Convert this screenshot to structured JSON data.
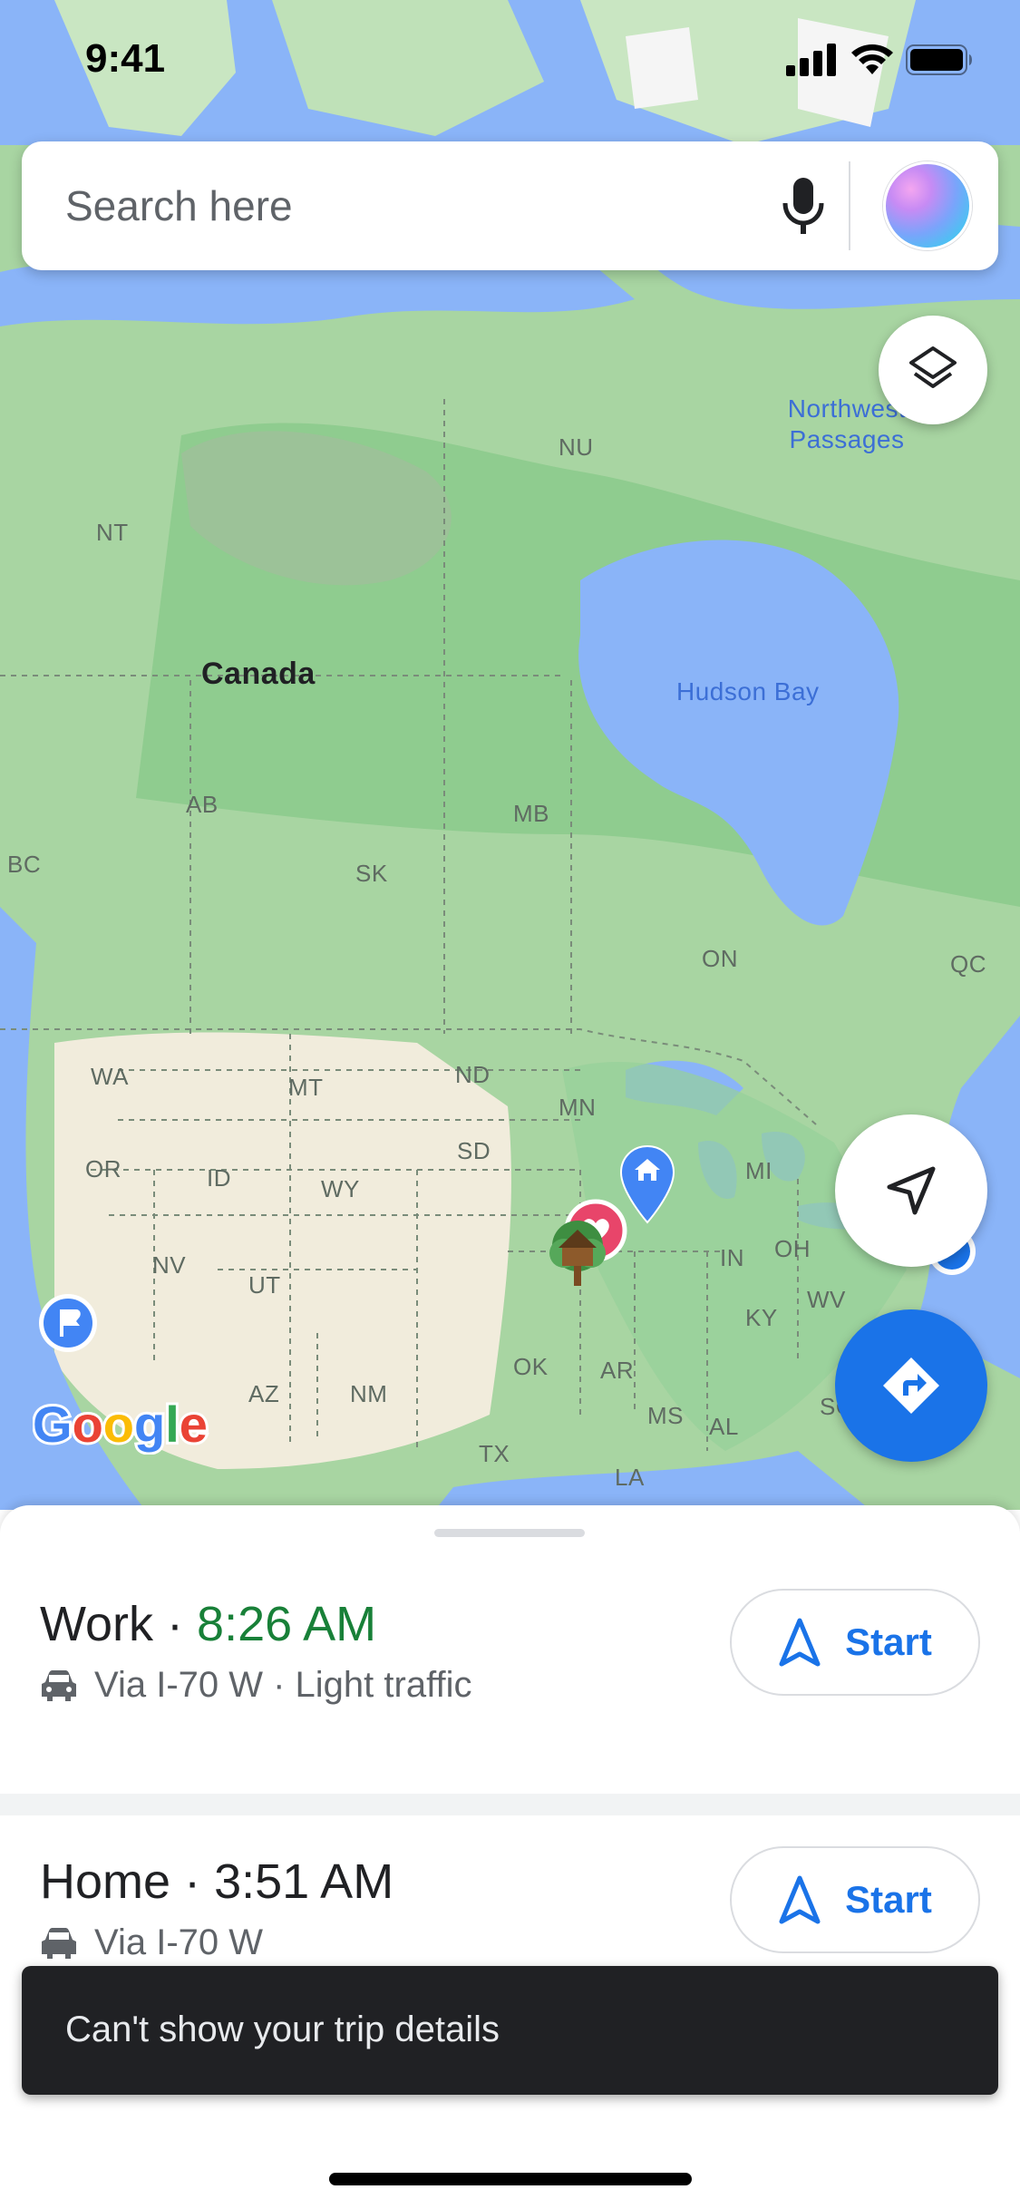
{
  "status_bar": {
    "time": "9:41"
  },
  "search": {
    "placeholder": "Search here"
  },
  "map": {
    "labels": {
      "nu": "NU",
      "nt": "NT",
      "canada": "Canada",
      "hudson_bay": "Hudson Bay",
      "northwest_passages": "Northwest\nPassages",
      "ab": "AB",
      "bc": "BC",
      "mb": "MB",
      "sk": "SK",
      "on": "ON",
      "qc": "QC",
      "wa": "WA",
      "mt": "MT",
      "nd": "ND",
      "mn": "MN",
      "or": "OR",
      "id": "ID",
      "wy": "WY",
      "sd": "SD",
      "mi": "MI",
      "nv": "NV",
      "ut": "UT",
      "in": "IN",
      "oh": "OH",
      "wv": "WV",
      "ky": "KY",
      "az": "AZ",
      "nm": "NM",
      "ok": "OK",
      "ar": "AR",
      "ms": "MS",
      "al": "AL",
      "sc": "SC",
      "tx": "TX",
      "la": "LA"
    },
    "logo": "Google",
    "markers": [
      "home-marker",
      "favorite-marker",
      "treehouse-marker",
      "parking-marker"
    ],
    "colors": {
      "water": "#8ab4f8",
      "land": "#a8d5a2",
      "forest": "#8fcc8f",
      "desert": "#f1ecdc",
      "ice": "#f5f5f5"
    }
  },
  "buttons": {
    "layers": "layers-icon",
    "my_location": "navigation-arrow-icon",
    "directions": "directions-icon"
  },
  "trips": [
    {
      "place": "Work",
      "separator": "·",
      "eta": "8:26 AM",
      "eta_color": "#188038",
      "route": "Via I-70 W · Light traffic",
      "start_label": "Start"
    },
    {
      "place": "Home",
      "separator": "·",
      "eta": "3:51 AM",
      "route": "Via I-70 W",
      "start_label": "Start"
    }
  ],
  "toast": {
    "message": "Can't show your trip details"
  },
  "accent_color": "#1a73e8"
}
